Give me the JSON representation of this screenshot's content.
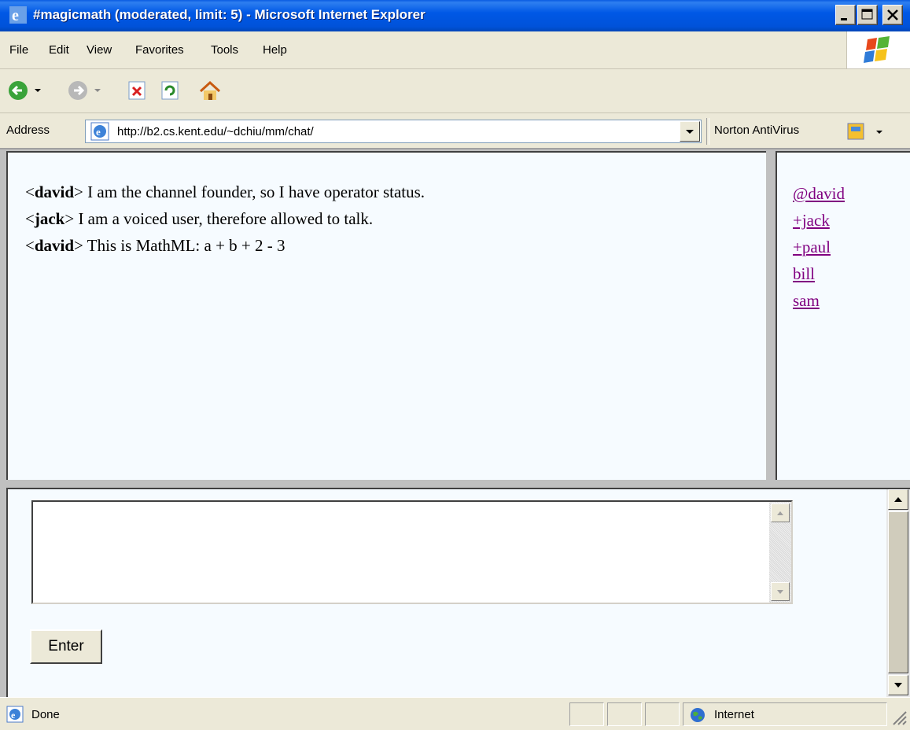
{
  "window": {
    "title": "#magicmath (moderated, limit: 5) - Microsoft Internet Explorer"
  },
  "menu": {
    "items": [
      "File",
      "Edit",
      "View",
      "Favorites",
      "Tools",
      "Help"
    ]
  },
  "toolbar": {
    "buttons": [
      "back-icon",
      "forward-icon",
      "stop-icon",
      "refresh-icon",
      "home-icon"
    ]
  },
  "address": {
    "label": "Address",
    "url": "http://b2.cs.kent.edu/~dchiu/mm/chat/"
  },
  "norton": {
    "label": "Norton AntiVirus"
  },
  "chat": {
    "messages": [
      {
        "open": "<",
        "nick": "david",
        "close": ">",
        "text": " I am the channel founder, so I have operator status."
      },
      {
        "open": "<",
        "nick": "jack",
        "close": ">",
        "text": " I am a voiced user, therefore allowed to talk."
      },
      {
        "open": "<",
        "nick": "david",
        "close": ">",
        "text": " This is MathML: a + b + 2 - 3"
      }
    ]
  },
  "users": [
    "@david",
    "+jack",
    "+paul",
    "bill",
    "sam"
  ],
  "input": {
    "value": "",
    "enter_label": "Enter"
  },
  "status": {
    "text": "Done",
    "zone": "Internet"
  },
  "colors": {
    "titlebar": "#0058e6",
    "link_visited": "#800080",
    "frame_bg": "#f6fbff"
  }
}
